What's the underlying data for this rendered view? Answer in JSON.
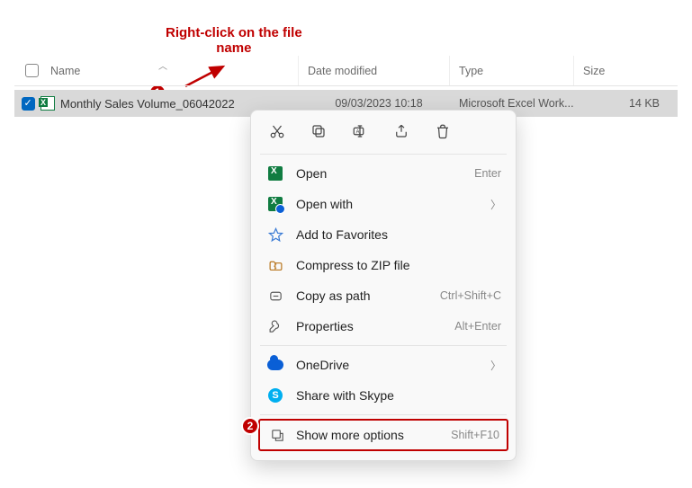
{
  "annotation": {
    "text": "Right-click on the file\nname",
    "badge1": "1",
    "badge2": "2"
  },
  "columns": {
    "name": "Name",
    "date": "Date modified",
    "type": "Type",
    "size": "Size"
  },
  "file": {
    "name": "Monthly Sales Volume_06042022",
    "date": "09/03/2023 10:18",
    "type": "Microsoft Excel Work...",
    "size": "14 KB"
  },
  "iconbar": {
    "cut": "cut-icon",
    "copy": "copy-icon",
    "rename": "rename-icon",
    "share": "share-icon",
    "delete": "delete-icon"
  },
  "menu": {
    "open": {
      "label": "Open",
      "hint": "Enter"
    },
    "openwith": {
      "label": "Open with"
    },
    "fav": {
      "label": "Add to Favorites"
    },
    "zip": {
      "label": "Compress to ZIP file"
    },
    "copypath": {
      "label": "Copy as path",
      "hint": "Ctrl+Shift+C"
    },
    "props": {
      "label": "Properties",
      "hint": "Alt+Enter"
    },
    "onedrive": {
      "label": "OneDrive"
    },
    "skype": {
      "label": "Share with Skype"
    },
    "more": {
      "label": "Show more options",
      "hint": "Shift+F10"
    }
  }
}
